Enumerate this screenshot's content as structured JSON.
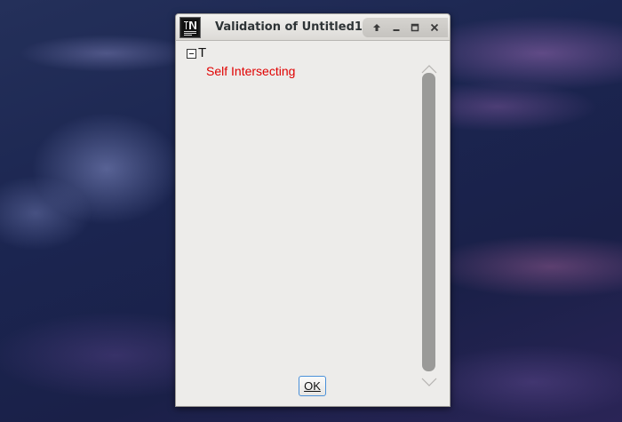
{
  "window": {
    "title": "Validation of Untitled1",
    "app_icon": "fontforge-app-icon",
    "buttons": {
      "up_icon": "arrow-up-icon",
      "minimize_icon": "minimize-icon",
      "maximize_icon": "maximize-icon",
      "close_icon": "close-icon"
    }
  },
  "tree": {
    "root": {
      "label": "T",
      "expanded": true,
      "expander_icon": "collapse-minus-icon"
    },
    "child": {
      "label": "Self Intersecting",
      "color": "#e00000"
    }
  },
  "dialog": {
    "ok_label": "OK"
  },
  "colors": {
    "window_bg": "#edecea",
    "error_text": "#e00000",
    "focus_border": "#4a90d9"
  }
}
